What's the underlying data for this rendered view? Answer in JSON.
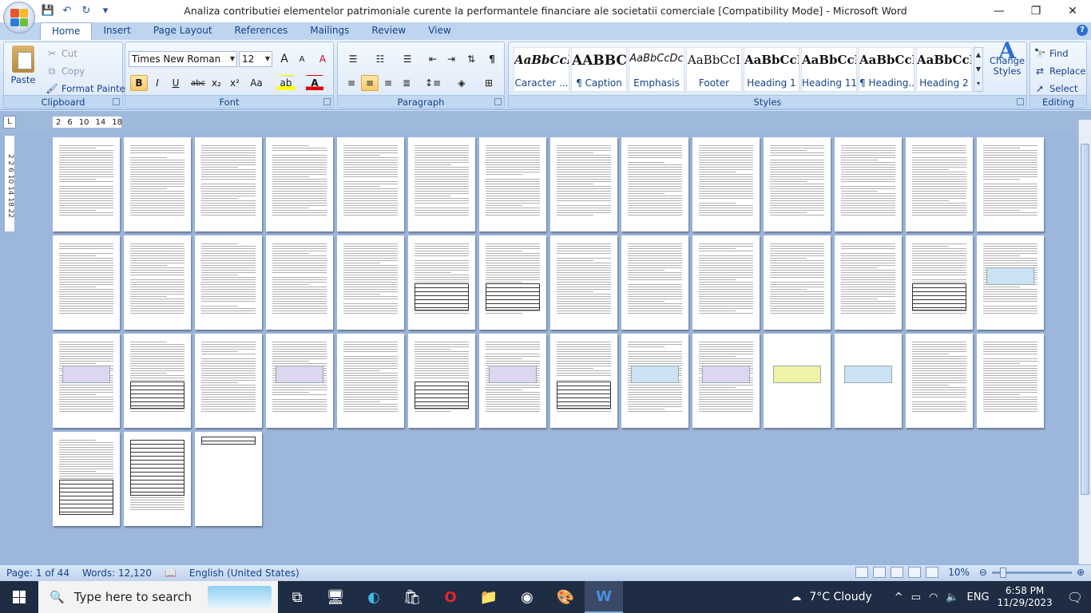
{
  "window": {
    "title": "Analiza contributiei elementelor patrimoniale curente la performantele financiare ale societatii comerciale [Compatibility Mode] - Microsoft Word",
    "min": "—",
    "max": "❐",
    "close": "✕"
  },
  "qat": {
    "save": "💾",
    "undo": "↶",
    "redo": "↻",
    "more": "▾"
  },
  "tabs": [
    "Home",
    "Insert",
    "Page Layout",
    "References",
    "Mailings",
    "Review",
    "View"
  ],
  "clipboard": {
    "label": "Clipboard",
    "paste": "Paste",
    "cut": "Cut",
    "copy": "Copy",
    "format_painter": "Format Painter"
  },
  "font": {
    "label": "Font",
    "name": "Times New Roman",
    "size": "12",
    "grow": "A",
    "shrink": "A",
    "clear": "A",
    "bold": "B",
    "italic": "I",
    "underline": "U",
    "strike": "abc",
    "sub": "x₂",
    "sup": "x²",
    "case": "Aa",
    "highlight": "ab",
    "color": "A"
  },
  "paragraph": {
    "label": "Paragraph",
    "pilcrow": "¶"
  },
  "styles": {
    "label": "Styles",
    "items": [
      {
        "sample": "AaBbCcI",
        "name": "Caracter ..."
      },
      {
        "sample": "AABBC",
        "name": "¶ Caption"
      },
      {
        "sample": "AaBbCcDc",
        "name": "Emphasis"
      },
      {
        "sample": "AaBbCcI",
        "name": "Footer"
      },
      {
        "sample": "AaBbCcI",
        "name": "Heading 1"
      },
      {
        "sample": "AaBbCcI",
        "name": "Heading 11"
      },
      {
        "sample": "AaBbCcI",
        "name": "¶ Heading..."
      },
      {
        "sample": "AaBbCcI",
        "name": "Heading 2"
      }
    ],
    "change": "Change Styles"
  },
  "editing": {
    "label": "Editing",
    "find": "Find",
    "replace": "Replace",
    "select": "Select"
  },
  "ruler": {
    "tab_marker": "L",
    "marks": [
      "2",
      "2",
      "6",
      "10",
      "14",
      "18"
    ],
    "v_marks": "2 2 6 10 14 18 22"
  },
  "status": {
    "page": "Page: 1 of 44",
    "words": "Words: 12,120",
    "language": "English (United States)",
    "zoom": "10%"
  },
  "taskbar": {
    "search_placeholder": "Type here to search",
    "weather": "7°C  Cloudy",
    "lang": "ENG",
    "time": "6:58 PM",
    "date": "11/29/2023"
  },
  "colors": {
    "accent": "#15428b",
    "ribbon": "#dce8f7",
    "canvas": "#9cb6dc",
    "taskbar": "#1e2d44"
  }
}
